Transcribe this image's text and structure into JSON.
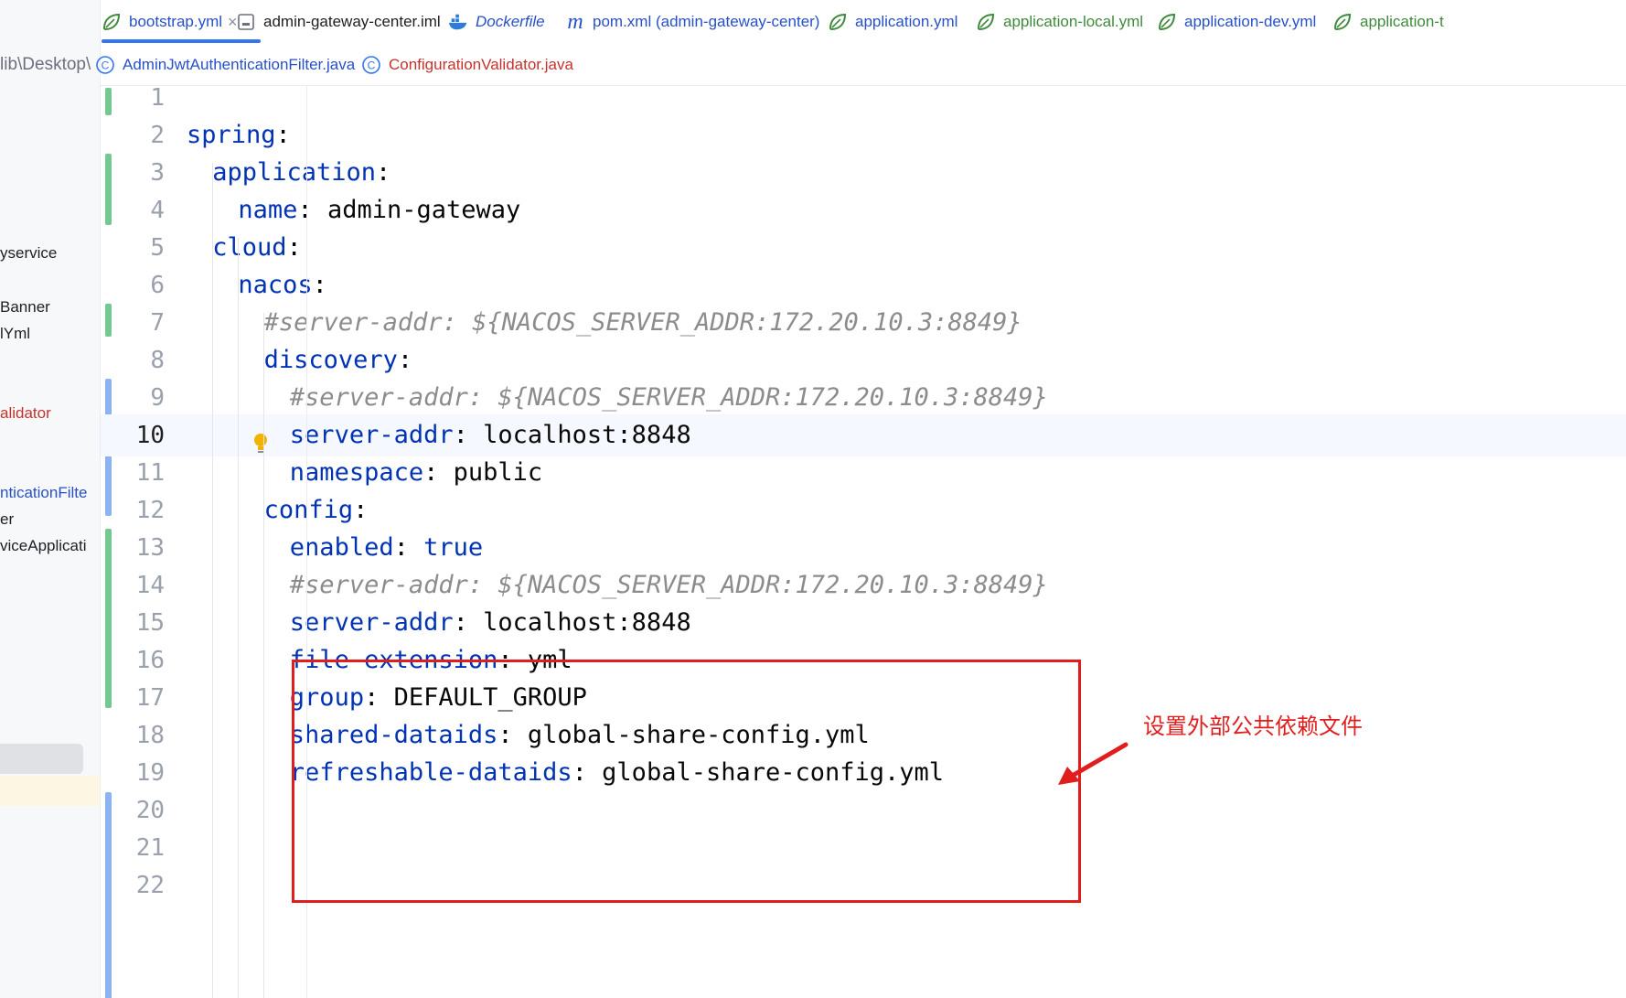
{
  "sidebar": {
    "path_fragment": "lib\\Desktop\\",
    "items": [
      {
        "label": "yservice",
        "style": "normal"
      },
      {
        "label": "Banner",
        "style": "normal"
      },
      {
        "label": "lYml",
        "style": "normal"
      },
      {
        "label": "alidator",
        "style": "red"
      },
      {
        "label": "nticationFilte",
        "style": "blue"
      },
      {
        "label": "er",
        "style": "normal"
      },
      {
        "label": "viceApplicati",
        "style": "normal"
      }
    ]
  },
  "tabs_row1": [
    {
      "label": "bootstrap.yml",
      "icon": "spring-leaf-icon",
      "style": "blue",
      "active": true,
      "close": "×"
    },
    {
      "label": "admin-gateway-center.iml",
      "icon": "module-file-icon",
      "style": "normal"
    },
    {
      "label": "Dockerfile",
      "icon": "docker-icon",
      "style": "italic-blue"
    },
    {
      "label": "pom.xml (admin-gateway-center)",
      "icon": "maven-icon",
      "icon_glyph": "m",
      "style": "blue"
    },
    {
      "label": "application.yml",
      "icon": "spring-leaf-icon",
      "style": "blue"
    },
    {
      "label": "application-local.yml",
      "icon": "spring-leaf-icon",
      "style": "green"
    },
    {
      "label": "application-dev.yml",
      "icon": "spring-leaf-icon",
      "style": "blue"
    },
    {
      "label": "application-t",
      "icon": "spring-leaf-icon",
      "style": "green"
    }
  ],
  "tabs_row2": [
    {
      "label": "AdminJwtAuthenticationFilter.java",
      "icon": "java-class-icon",
      "icon_glyph": "C",
      "style": "blue"
    },
    {
      "label": "ConfigurationValidator.java",
      "icon": "java-class-icon",
      "icon_glyph": "C",
      "style": "red"
    }
  ],
  "editor": {
    "current_line": 10,
    "lines": [
      {
        "n": "1",
        "key": "",
        "val": "",
        "indent": 0
      },
      {
        "n": "2",
        "key": "spring",
        "val": "",
        "indent": 0
      },
      {
        "n": "3",
        "key": "application",
        "val": "",
        "indent": 1
      },
      {
        "n": "4",
        "key": "name",
        "val": "admin-gateway",
        "indent": 2
      },
      {
        "n": "5",
        "key": "cloud",
        "val": "",
        "indent": 1
      },
      {
        "n": "6",
        "key": "nacos",
        "val": "",
        "indent": 2
      },
      {
        "n": "7",
        "comment": "#server-addr: ${NACOS_SERVER_ADDR:172.20.10.3:8849}",
        "indent": 3
      },
      {
        "n": "8",
        "key": "discovery",
        "val": "",
        "indent": 3
      },
      {
        "n": "9",
        "comment": "#server-addr: ${NACOS_SERVER_ADDR:172.20.10.3:8849}",
        "indent": 4
      },
      {
        "n": "10",
        "key": "server-addr",
        "val": "localhost:8848",
        "indent": 4
      },
      {
        "n": "11",
        "key": "namespace",
        "val": "public",
        "indent": 4
      },
      {
        "n": "12",
        "key": "config",
        "val": "",
        "indent": 3
      },
      {
        "n": "13",
        "key": "enabled",
        "val": "true",
        "val_kw": true,
        "indent": 4
      },
      {
        "n": "14",
        "comment": "#server-addr: ${NACOS_SERVER_ADDR:172.20.10.3:8849}",
        "indent": 4
      },
      {
        "n": "15",
        "key": "server-addr",
        "val": "localhost:8848",
        "indent": 4
      },
      {
        "n": "16",
        "key": "file-extension",
        "val": "yml",
        "indent": 4
      },
      {
        "n": "17",
        "key": "group",
        "val": "DEFAULT_GROUP",
        "indent": 4
      },
      {
        "n": "18",
        "key": "shared-dataids",
        "val": "global-share-config.yml",
        "indent": 4
      },
      {
        "n": "19",
        "key": "refreshable-dataids",
        "val": "global-share-config.yml",
        "indent": 4
      },
      {
        "n": "20",
        "key": "",
        "val": "",
        "indent": 0
      },
      {
        "n": "21",
        "key": "",
        "val": "",
        "indent": 0
      },
      {
        "n": "22",
        "key": "",
        "val": "",
        "indent": 0
      }
    ]
  },
  "annotation": {
    "text": "设置外部公共依赖文件",
    "color": "#e01e1e"
  },
  "colors": {
    "key": "#0033b3",
    "comment": "#8c8c8c",
    "accent": "#3574f0",
    "vcs_added": "#73c991",
    "vcs_modified": "#8db4f2"
  }
}
